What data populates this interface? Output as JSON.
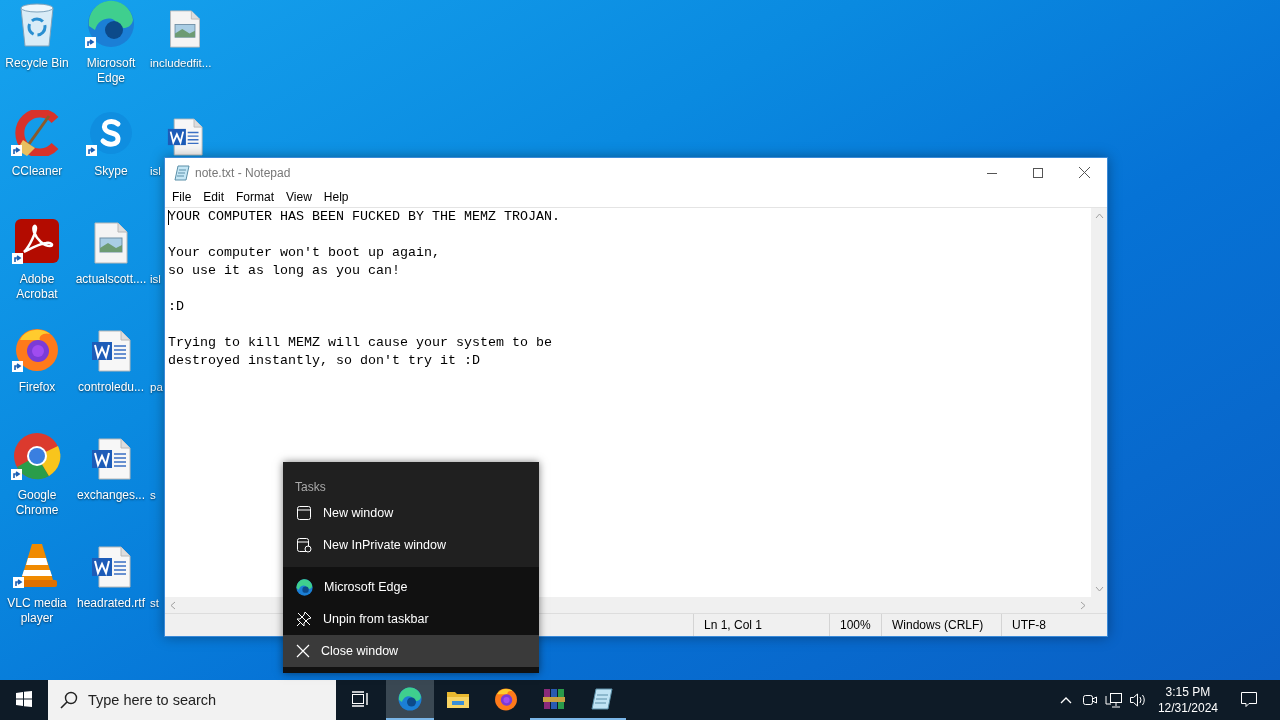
{
  "desktop": {
    "icons": [
      {
        "label": "Recycle Bin",
        "kind": "recycle",
        "shortcut": false
      },
      {
        "label": "CCleaner",
        "kind": "ccleaner",
        "shortcut": true
      },
      {
        "label": "Adobe Acrobat",
        "kind": "acrobat",
        "shortcut": true
      },
      {
        "label": "Firefox",
        "kind": "firefox",
        "shortcut": true
      },
      {
        "label": "Google Chrome",
        "kind": "chrome",
        "shortcut": true
      },
      {
        "label": "VLC media player",
        "kind": "vlc",
        "shortcut": true
      },
      {
        "label": "Microsoft Edge",
        "kind": "edge",
        "shortcut": true
      },
      {
        "label": "Skype",
        "kind": "skype",
        "shortcut": true
      },
      {
        "label": "actualscott....",
        "kind": "image",
        "shortcut": false
      },
      {
        "label": "controledu...",
        "kind": "word",
        "shortcut": false
      },
      {
        "label": "exchanges...",
        "kind": "word",
        "shortcut": false
      },
      {
        "label": "headrated.rtf",
        "kind": "word",
        "shortcut": false
      },
      {
        "label": "includedfit...",
        "kind": "image",
        "shortcut": false
      },
      {
        "label": "isl",
        "kind": "word",
        "shortcut": false
      },
      {
        "label": "isl"
      },
      {
        "label": "pa"
      },
      {
        "label": "s"
      },
      {
        "label": "st"
      }
    ]
  },
  "notepad": {
    "title": "note.txt - Notepad",
    "menu": [
      "File",
      "Edit",
      "Format",
      "View",
      "Help"
    ],
    "text": "YOUR COMPUTER HAS BEEN FUCKED BY THE MEMZ TROJAN.\n\nYour computer won't boot up again,\nso use it as long as you can!\n\n:D\n\nTrying to kill MEMZ will cause your system to be\ndestroyed instantly, so don't try it :D",
    "status": [
      "Ln 1, Col 1",
      "100%",
      "Windows (CRLF)",
      "UTF-8"
    ]
  },
  "jump_list": {
    "heading": "Tasks",
    "sections": [
      [
        {
          "label": "New window",
          "kind": "window",
          "selected": false
        },
        {
          "label": "New InPrivate window",
          "kind": "inprivate",
          "selected": false
        }
      ],
      [
        {
          "label": "Microsoft Edge",
          "kind": "edge",
          "selected": false
        },
        {
          "label": "Unpin from taskbar",
          "kind": "unpin",
          "selected": false
        },
        {
          "label": "Close window",
          "kind": "close",
          "selected": true
        }
      ]
    ]
  },
  "taskbar": {
    "search_placeholder": "Type here to search",
    "apps": [
      {
        "kind": "edge",
        "selected": true,
        "running": true
      },
      {
        "kind": "folder",
        "selected": false,
        "running": false
      },
      {
        "kind": "firefox",
        "selected": false,
        "running": false
      },
      {
        "kind": "winrar",
        "selected": false,
        "running": true
      },
      {
        "kind": "notepad",
        "selected": false,
        "running": true
      }
    ],
    "time": "3:15 PM",
    "date": "12/31/2024"
  }
}
